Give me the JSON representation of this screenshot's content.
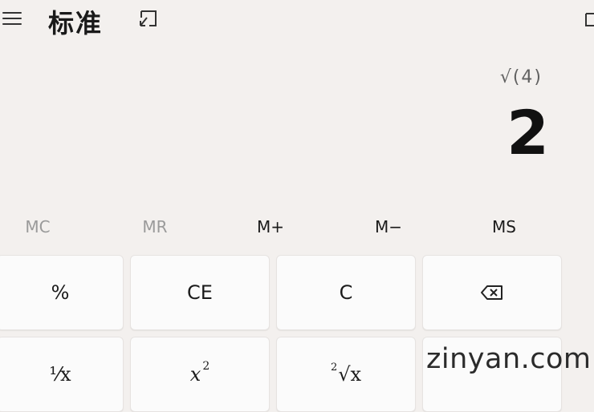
{
  "header": {
    "title": "标准"
  },
  "display": {
    "expression": "√(4)",
    "result": "2"
  },
  "memory": {
    "mc": "MC",
    "mr": "MR",
    "m_plus": "M+",
    "m_minus": "M−",
    "ms": "MS"
  },
  "keys": {
    "percent": "%",
    "ce": "CE",
    "c": "C",
    "reciprocal": "⅟x",
    "square_base": "x",
    "square_exp": "2",
    "root_index": "2",
    "root_body": "√x"
  },
  "watermark": "zinyan.com",
  "icons": [
    "hamburger-menu-icon",
    "keep-on-top-icon",
    "history-icon",
    "backspace-icon"
  ]
}
